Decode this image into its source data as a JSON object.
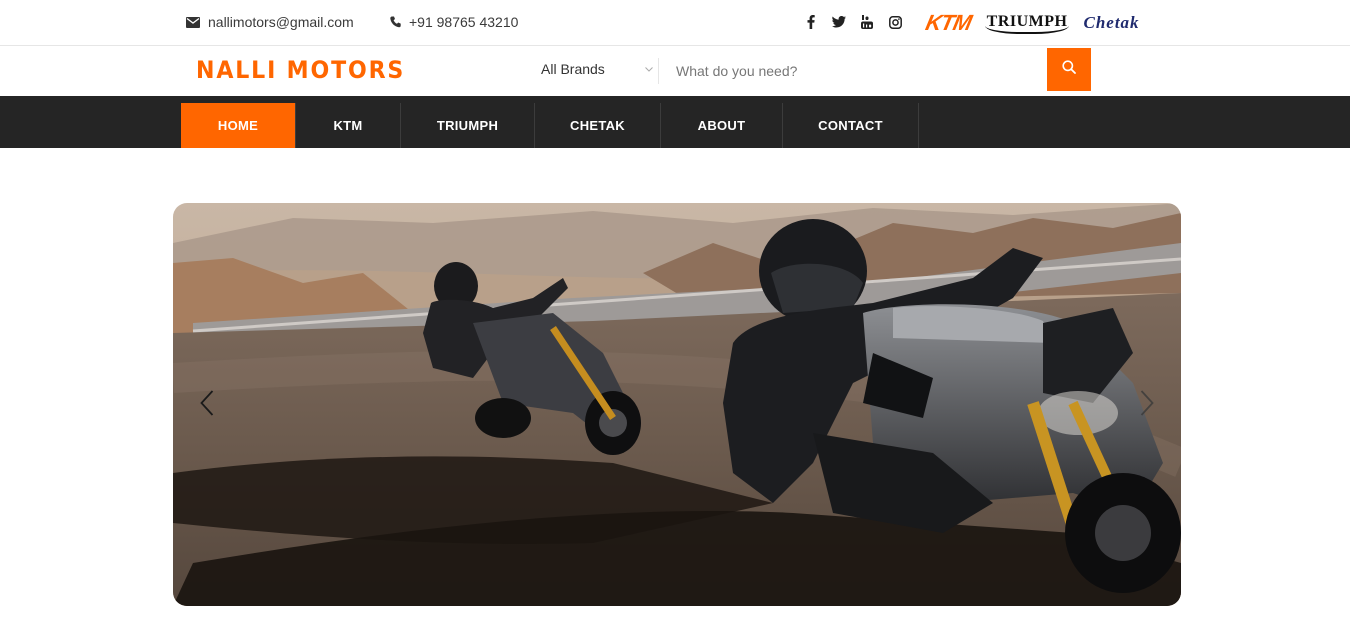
{
  "topbar": {
    "email": "nallimotors@gmail.com",
    "phone": "+91 98765 43210",
    "social_icons": [
      "facebook-icon",
      "twitter-icon",
      "youtube-icon",
      "instagram-icon"
    ],
    "brand_logos": {
      "ktm": "KTM",
      "triumph": "TRIUMPH",
      "chetak": "Chetak"
    }
  },
  "header": {
    "site_title": "NALLI MOTORS",
    "brand_filter": "All Brands",
    "search_placeholder": "What do you need?"
  },
  "nav": {
    "items": [
      {
        "label": "HOME"
      },
      {
        "label": "KTM"
      },
      {
        "label": "TRIUMPH"
      },
      {
        "label": "CHETAK"
      },
      {
        "label": "ABOUT"
      },
      {
        "label": "CONTACT"
      }
    ],
    "active": "HOME"
  },
  "colors": {
    "accent": "#ff6600",
    "nav_bg": "#252525",
    "chetak_blue": "#1f2a6e"
  }
}
